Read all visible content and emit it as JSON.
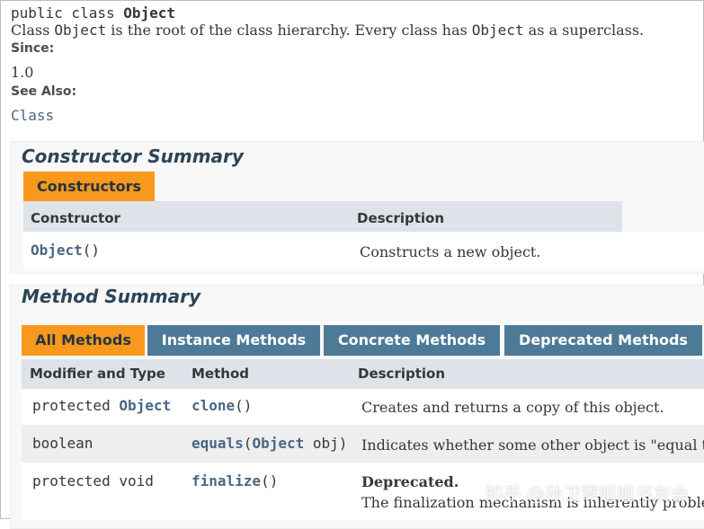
{
  "header": {
    "signature_prefix": "public class ",
    "signature_name": "Object",
    "desc_a": "Class ",
    "desc_code1": "Object",
    "desc_b": " is the root of the class hierarchy. Every class has ",
    "desc_code2": "Object",
    "desc_c": " as a superclass.",
    "since_label": "Since:",
    "since_value": "1.0",
    "see_also_label": "See Also:",
    "see_also_link": "Class"
  },
  "constructor_summary": {
    "title": "Constructor Summary",
    "tab_label": "Constructors",
    "columns": [
      "Constructor",
      "Description"
    ],
    "rows": [
      {
        "name": "Object",
        "params": "()",
        "description": "Constructs a new object."
      }
    ]
  },
  "method_summary": {
    "title": "Method Summary",
    "tabs": [
      {
        "label": "All Methods",
        "active": true
      },
      {
        "label": "Instance Methods",
        "active": false
      },
      {
        "label": "Concrete Methods",
        "active": false
      },
      {
        "label": "Deprecated Methods",
        "active": false
      }
    ],
    "columns": [
      "Modifier and Type",
      "Method",
      "Description"
    ],
    "rows": [
      {
        "modifier_prefix": "protected ",
        "modifier_type": "Object",
        "method": "clone",
        "params": "()",
        "description": "Creates and returns a copy of this object."
      },
      {
        "modifier_prefix": "boolean",
        "modifier_type": "",
        "method": "equals",
        "params_open": "(",
        "param_type": "Object",
        "params_rest": " obj)",
        "description": "Indicates whether some other object is \"equal to\" this one."
      },
      {
        "modifier_prefix": "protected void",
        "modifier_type": "",
        "method": "finalize",
        "params": "()",
        "deprecated_label": "Deprecated.",
        "description": "The finalization mechanism is inherently problematic."
      }
    ]
  },
  "watermark": "知乎 @孙卫琴姐姐书友会",
  "colors": {
    "active_tab": "#F8981D",
    "inactive_tab": "#4D7A97",
    "table_header": "#dee3e9",
    "link": "#4A6782"
  }
}
